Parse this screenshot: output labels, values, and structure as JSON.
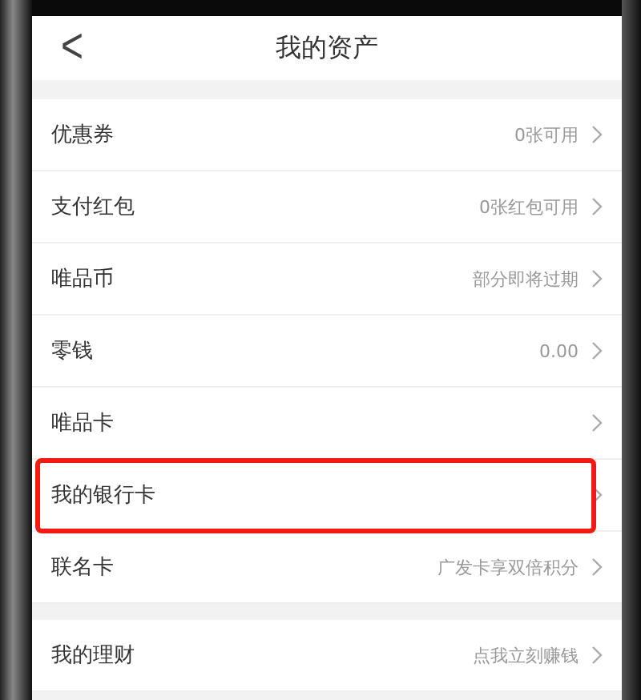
{
  "header": {
    "back": "<",
    "title": "我的资产"
  },
  "sections": [
    {
      "items": [
        {
          "label": "优惠券",
          "value": "0张可用",
          "highlighted": false
        },
        {
          "label": "支付红包",
          "value": "0张红包可用",
          "highlighted": false
        },
        {
          "label": "唯品币",
          "value": "部分即将过期",
          "highlighted": false
        },
        {
          "label": "零钱",
          "value": "0.00",
          "highlighted": false
        },
        {
          "label": "唯品卡",
          "highlighted": false
        },
        {
          "label": "我的银行卡",
          "highlighted": true
        },
        {
          "label": "联名卡",
          "value": "广发卡享双倍积分",
          "highlighted": false
        }
      ]
    },
    {
      "items": [
        {
          "label": "我的理财",
          "value": "点我立刻赚钱",
          "highlighted": false
        }
      ]
    }
  ]
}
